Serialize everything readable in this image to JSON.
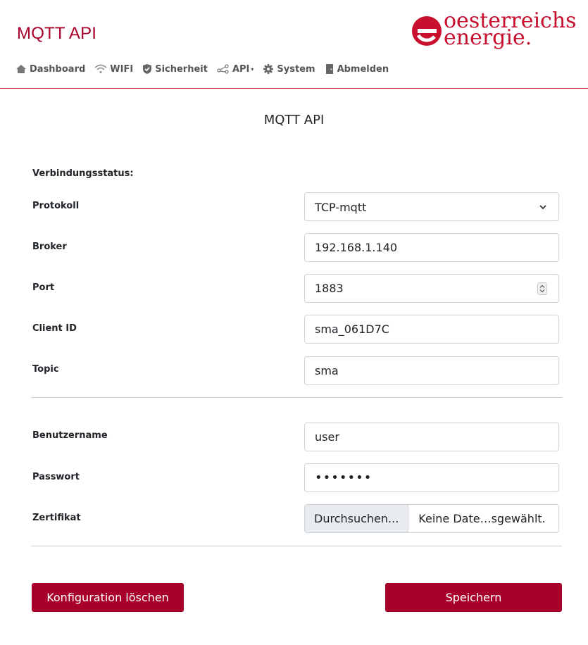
{
  "header": {
    "title": "MQTT API",
    "logo": {
      "line1": "oesterreichs",
      "line2": "energie.",
      "color": "#c8102e"
    }
  },
  "nav": [
    {
      "label": "Dashboard",
      "icon": "home-icon"
    },
    {
      "label": "WIFI",
      "icon": "wifi-icon"
    },
    {
      "label": "Sicherheit",
      "icon": "shield-icon"
    },
    {
      "label": "API",
      "icon": "share-icon",
      "dropdown": true
    },
    {
      "label": "System",
      "icon": "gear-icon"
    },
    {
      "label": "Abmelden",
      "icon": "door-icon"
    }
  ],
  "page": {
    "title": "MQTT API"
  },
  "form": {
    "status_label": "Verbindungsstatus:",
    "protocol": {
      "label": "Protokoll",
      "value": "TCP-mqtt"
    },
    "broker": {
      "label": "Broker",
      "value": "192.168.1.140"
    },
    "port": {
      "label": "Port",
      "value": "1883"
    },
    "client_id": {
      "label": "Client ID",
      "value": "sma_061D7C"
    },
    "topic": {
      "label": "Topic",
      "value": "sma"
    },
    "username": {
      "label": "Benutzername",
      "value": "user"
    },
    "password": {
      "label": "Passwort",
      "value": "•••••••"
    },
    "certificate": {
      "label": "Zertifikat",
      "button": "Durchsuchen...",
      "filename": "Keine Date…sgewählt."
    }
  },
  "buttons": {
    "clear": "Konfiguration löschen",
    "save": "Speichern"
  },
  "colors": {
    "accent": "#a8002a",
    "divider": "#c8354b"
  }
}
